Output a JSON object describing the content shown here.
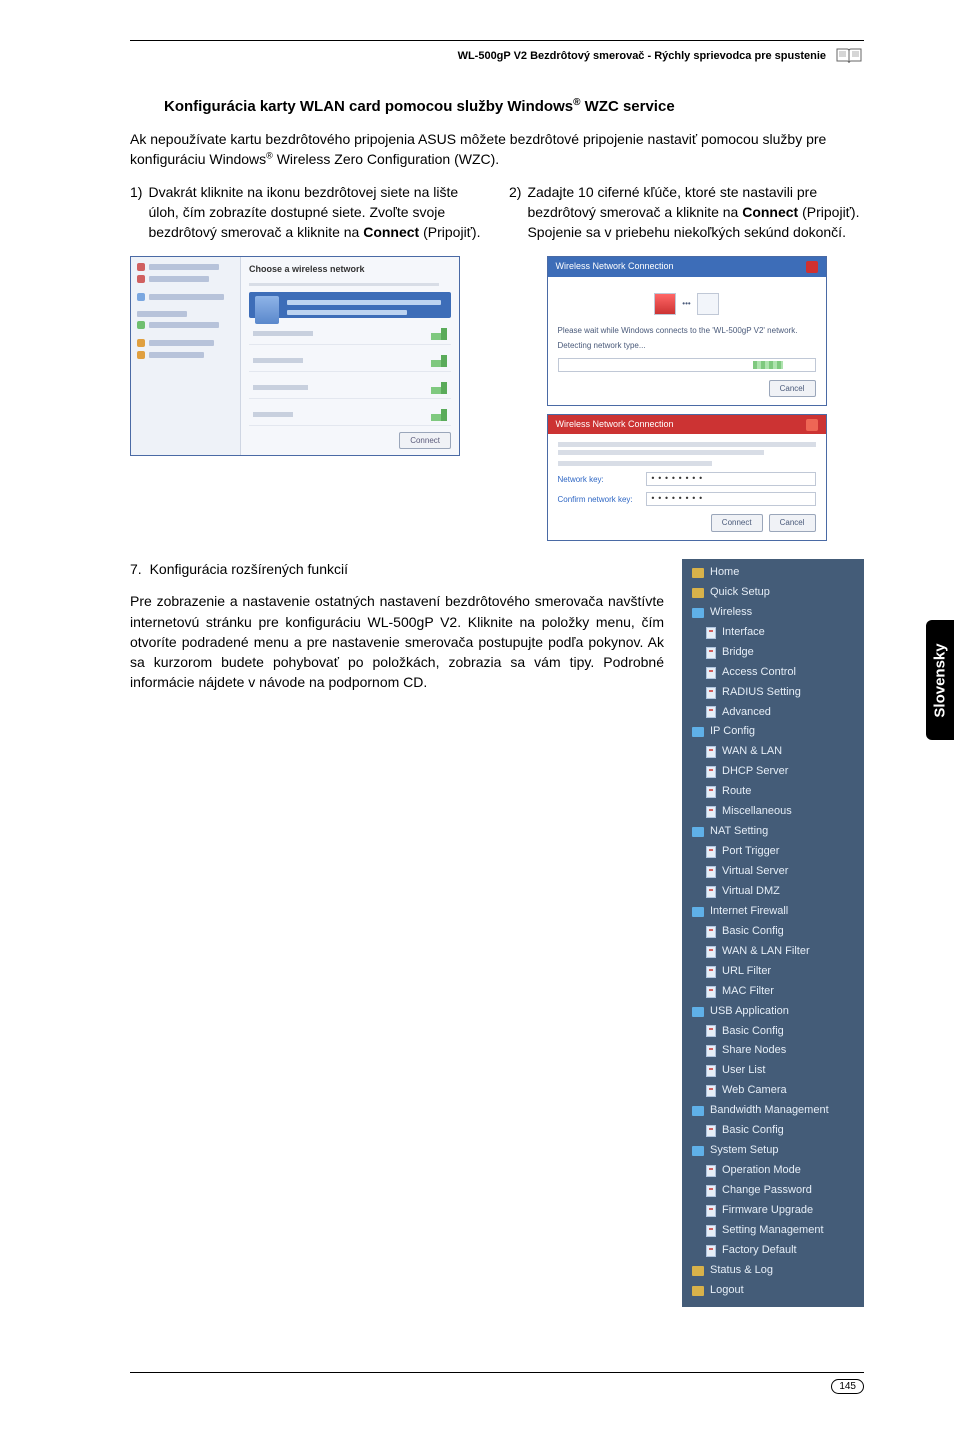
{
  "header": {
    "title": "WL-500gP V2 Bezdrôtový smerovač - Rýchly sprievodca pre spustenie"
  },
  "section": {
    "title_pre": "Konfigurácia karty WLAN card pomocou služby Windows",
    "title_sup": "®",
    "title_post": " WZC service"
  },
  "intro": {
    "line1_pre": "Ak nepoužívate kartu bezdrôtového pripojenia ASUS môžete bezdrôtové pripojenie nastaviť pomocou služby pre konfiguráciu Windows",
    "line1_sup": "®",
    "line1_post": " Wireless Zero Configuration (WZC)."
  },
  "step1": {
    "num": "1)",
    "text_a": "Dvakrát kliknite na ikonu bezdrôtovej siete na lište úloh, čím zobrazíte dostupné siete. Zvoľte svoje bezdrôtový smerovač a kliknite na ",
    "bold": "Connect",
    "text_b": " (Pripojiť)."
  },
  "step2": {
    "num": "2)",
    "text_a": "Zadajte 10 ciferné kľúče, ktoré ste nastavili pre bezdrôtový smerovač a kliknite na ",
    "bold": "Connect",
    "text_b": " (Pripojiť). Spojenie sa v priebehu niekoľkých sekúnd dokončí."
  },
  "shot1": {
    "title": "Choose a wireless network",
    "connect": "Connect"
  },
  "shot2a": {
    "title": "Wireless Network Connection",
    "msg": "Please wait while Windows connects to the 'WL-500gP V2' network.",
    "status": "Detecting network type...",
    "cancel": "Cancel"
  },
  "shot2b": {
    "title": "Wireless Network Connection",
    "lab1": "Network key:",
    "lab2": "Confirm network key:",
    "dots": "••••••••",
    "connect": "Connect",
    "cancel": "Cancel"
  },
  "sec7": {
    "num": "7.",
    "title": "Konfigurácia rozšírených funkcií",
    "body": "Pre zobrazenie a nastavenie ostatných nastavení bezdrôtového smerovača navštívte internetovú stránku pre konfiguráciu WL-500gP V2. Kliknite na položky menu, čím otvoríte podradené menu a pre nastavenie smerovača postupujte podľa pokynov. Ak sa kurzorom budete pohybovať po položkách, zobrazia sa vám tipy. Podrobné informácie nájdete v návode na podpornom CD."
  },
  "menu": {
    "items": [
      {
        "t": "Home",
        "cls": "top",
        "ic": "folder"
      },
      {
        "t": "Quick Setup",
        "cls": "top",
        "ic": "folder"
      },
      {
        "t": "Wireless",
        "cls": "top",
        "ic": "folder-open"
      },
      {
        "t": "Interface",
        "cls": "sub",
        "ic": "page"
      },
      {
        "t": "Bridge",
        "cls": "sub",
        "ic": "page"
      },
      {
        "t": "Access Control",
        "cls": "sub",
        "ic": "page"
      },
      {
        "t": "RADIUS Setting",
        "cls": "sub",
        "ic": "page"
      },
      {
        "t": "Advanced",
        "cls": "sub",
        "ic": "page"
      },
      {
        "t": "IP Config",
        "cls": "top",
        "ic": "folder-open"
      },
      {
        "t": "WAN & LAN",
        "cls": "sub",
        "ic": "page"
      },
      {
        "t": "DHCP Server",
        "cls": "sub",
        "ic": "page"
      },
      {
        "t": "Route",
        "cls": "sub",
        "ic": "page"
      },
      {
        "t": "Miscellaneous",
        "cls": "sub",
        "ic": "page"
      },
      {
        "t": "NAT Setting",
        "cls": "top",
        "ic": "folder-open"
      },
      {
        "t": "Port Trigger",
        "cls": "sub",
        "ic": "page"
      },
      {
        "t": "Virtual Server",
        "cls": "sub",
        "ic": "page"
      },
      {
        "t": "Virtual DMZ",
        "cls": "sub",
        "ic": "page"
      },
      {
        "t": "Internet Firewall",
        "cls": "top",
        "ic": "folder-open"
      },
      {
        "t": "Basic Config",
        "cls": "sub",
        "ic": "page"
      },
      {
        "t": "WAN & LAN Filter",
        "cls": "sub",
        "ic": "page"
      },
      {
        "t": "URL Filter",
        "cls": "sub",
        "ic": "page"
      },
      {
        "t": "MAC Filter",
        "cls": "sub",
        "ic": "page"
      },
      {
        "t": "USB Application",
        "cls": "top",
        "ic": "folder-open"
      },
      {
        "t": "Basic Config",
        "cls": "sub",
        "ic": "page"
      },
      {
        "t": "Share Nodes",
        "cls": "sub",
        "ic": "page"
      },
      {
        "t": "User List",
        "cls": "sub",
        "ic": "page"
      },
      {
        "t": "Web Camera",
        "cls": "sub",
        "ic": "page"
      },
      {
        "t": "Bandwidth Management",
        "cls": "top",
        "ic": "folder-open"
      },
      {
        "t": "Basic Config",
        "cls": "sub",
        "ic": "page"
      },
      {
        "t": "System Setup",
        "cls": "top",
        "ic": "folder-open"
      },
      {
        "t": "Operation Mode",
        "cls": "sub",
        "ic": "page"
      },
      {
        "t": "Change Password",
        "cls": "sub",
        "ic": "page"
      },
      {
        "t": "Firmware Upgrade",
        "cls": "sub",
        "ic": "page"
      },
      {
        "t": "Setting Management",
        "cls": "sub",
        "ic": "page"
      },
      {
        "t": "Factory Default",
        "cls": "sub",
        "ic": "page"
      },
      {
        "t": "Status & Log",
        "cls": "top",
        "ic": "folder"
      },
      {
        "t": "Logout",
        "cls": "top",
        "ic": "folder"
      }
    ]
  },
  "sidetab": "Slovensky",
  "pagenum": "145"
}
